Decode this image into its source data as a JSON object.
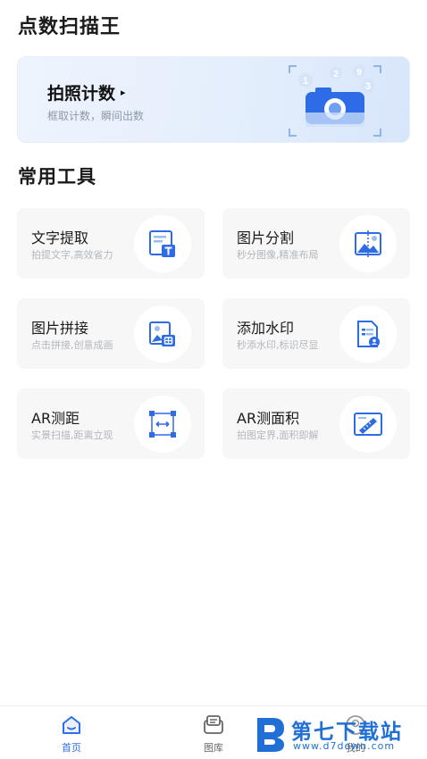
{
  "app": {
    "title": "点数扫描王"
  },
  "banner": {
    "title": "拍照计数",
    "arrow": "▸",
    "subtitle": "框取计数，瞬间出数",
    "art_digits": [
      "1",
      "2",
      "3",
      "9"
    ]
  },
  "tools_section": {
    "title": "常用工具"
  },
  "tools": [
    {
      "name": "文字提取",
      "desc": "拍提文字,高效省力",
      "icon": "text-extract-icon"
    },
    {
      "name": "图片分割",
      "desc": "秒分图像,精准布局",
      "icon": "image-split-icon"
    },
    {
      "name": "图片拼接",
      "desc": "点击拼接,创意成画",
      "icon": "image-stitch-icon"
    },
    {
      "name": "添加水印",
      "desc": "秒添水印,标识尽显",
      "icon": "watermark-doc-icon"
    },
    {
      "name": "AR测距",
      "desc": "实景扫描,距离立现",
      "icon": "ar-ruler-icon"
    },
    {
      "name": "AR测面积",
      "desc": "拍图定界,面积即解",
      "icon": "ar-area-icon"
    }
  ],
  "tabbar": {
    "items": [
      {
        "label": "首页",
        "icon": "home-icon",
        "active": true
      },
      {
        "label": "图库",
        "icon": "gallery-icon",
        "active": false
      },
      {
        "label": "我的",
        "icon": "profile-icon",
        "active": false
      }
    ]
  },
  "watermark": {
    "name": "第七下载站",
    "url": "www.d7down.com"
  },
  "colors": {
    "accent": "#2f6fe8",
    "icon_blue": "#2e6be6",
    "card_bg": "#f7f7f8",
    "watermark": "#1f6fd6"
  }
}
